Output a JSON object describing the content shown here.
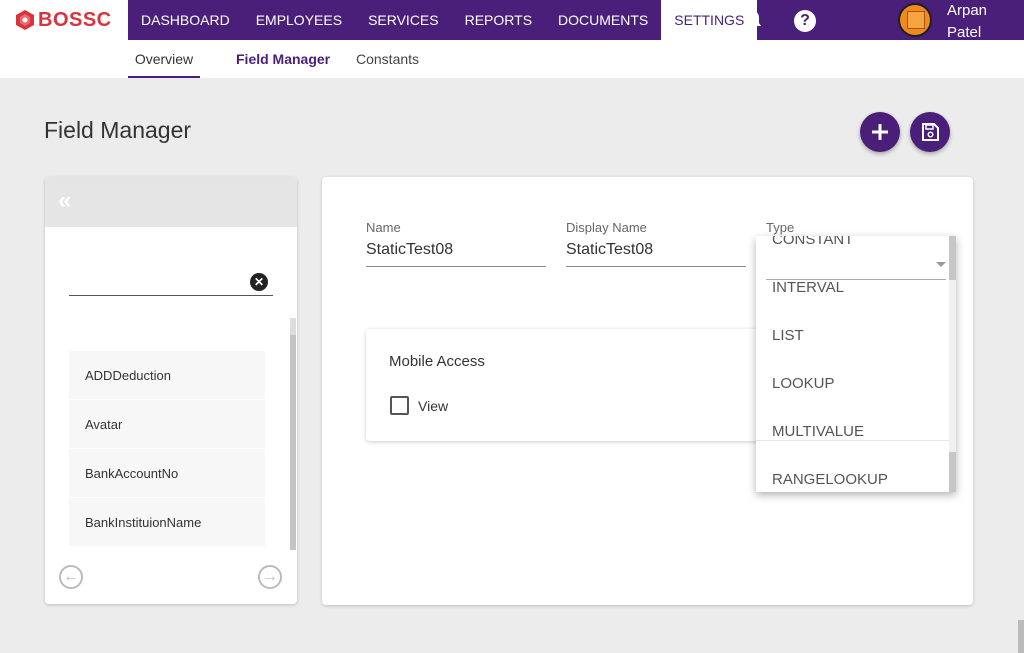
{
  "app": {
    "logo_text": "BOSSC"
  },
  "nav": {
    "items": [
      {
        "label": "DASHBOARD"
      },
      {
        "label": "EMPLOYEES"
      },
      {
        "label": "SERVICES"
      },
      {
        "label": "REPORTS"
      },
      {
        "label": "DOCUMENTS"
      },
      {
        "label": "SETTINGS"
      }
    ],
    "help_glyph": "?"
  },
  "user": {
    "first_name": "Arpan",
    "last_name": "Patel"
  },
  "subtabs": [
    {
      "label": "Overview"
    },
    {
      "label": "Field Manager"
    },
    {
      "label": "Constants"
    }
  ],
  "page": {
    "title": "Field Manager"
  },
  "left_panel": {
    "collapse_glyph": "«",
    "clear_glyph": "✕",
    "items": [
      {
        "label": "ADDDeduction"
      },
      {
        "label": "Avatar"
      },
      {
        "label": "BankAccountNo"
      },
      {
        "label": "BankInstituionName"
      }
    ],
    "prev_glyph": "←",
    "next_glyph": "→"
  },
  "form": {
    "name": {
      "label": "Name",
      "value": "StaticTest08"
    },
    "display_name": {
      "label": "Display Name",
      "value": "StaticTest08"
    },
    "type": {
      "label": "Type"
    }
  },
  "mobile_access": {
    "title": "Mobile Access",
    "view_label": "View"
  },
  "type_dropdown": {
    "options": [
      "CONSTANT",
      "INTERVAL",
      "LIST",
      "LOOKUP",
      "MULTIVALUE",
      "RANGELOOKUP"
    ]
  },
  "colors": {
    "primary": "#4a1f7a",
    "brand_red": "#d8343e",
    "avatar_orange": "#f08a1c"
  }
}
